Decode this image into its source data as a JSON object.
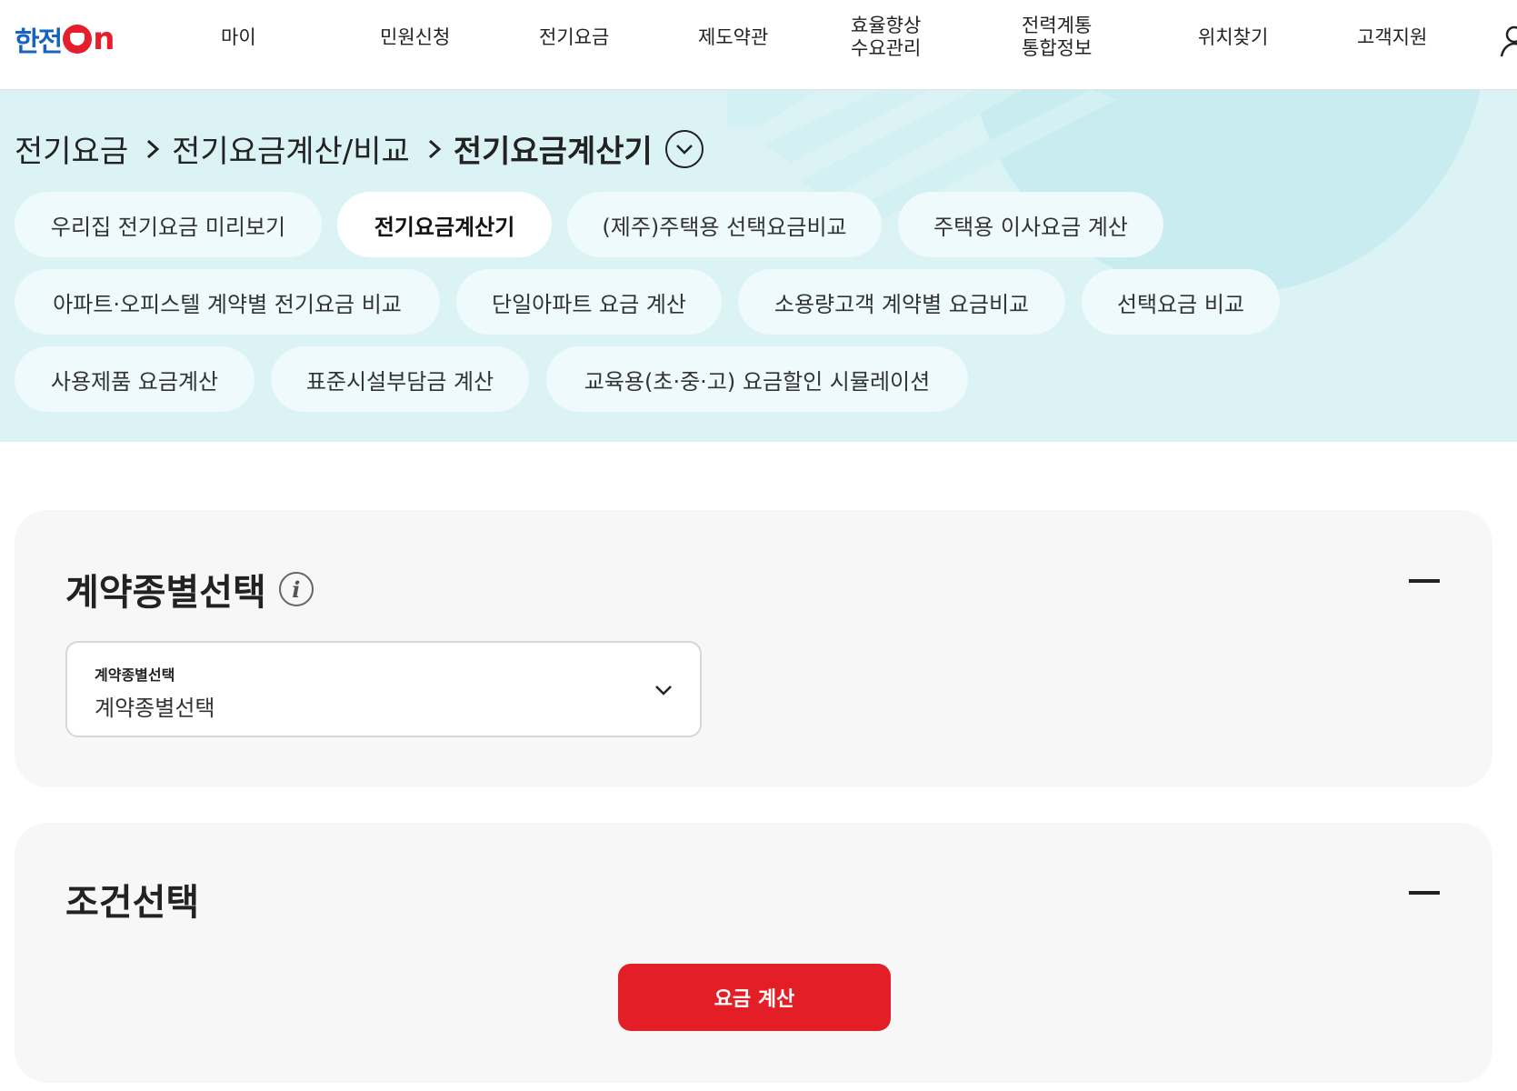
{
  "header": {
    "logo_text": "한전",
    "logo_on": "n",
    "nav": [
      {
        "line1": "마이",
        "line2": ""
      },
      {
        "line1": "민원신청",
        "line2": ""
      },
      {
        "line1": "전기요금",
        "line2": ""
      },
      {
        "line1": "제도약관",
        "line2": ""
      },
      {
        "line1": "효율향상",
        "line2": "수요관리"
      },
      {
        "line1": "전력계통",
        "line2": "통합정보"
      },
      {
        "line1": "위치찾기",
        "line2": ""
      },
      {
        "line1": "고객지원",
        "line2": ""
      }
    ]
  },
  "breadcrumb": {
    "items": [
      "전기요금",
      "전기요금계산/비교"
    ],
    "current": "전기요금계산기"
  },
  "chips": [
    {
      "label": "우리집 전기요금 미리보기",
      "active": false
    },
    {
      "label": "전기요금계산기",
      "active": true
    },
    {
      "label": "(제주)주택용 선택요금비교",
      "active": false
    },
    {
      "label": "주택용 이사요금 계산",
      "active": false
    },
    {
      "label": "아파트·오피스텔 계약별 전기요금 비교",
      "active": false
    },
    {
      "label": "단일아파트 요금 계산",
      "active": false
    },
    {
      "label": "소용량고객 계약별 요금비교",
      "active": false
    },
    {
      "label": "선택요금 비교",
      "active": false
    },
    {
      "label": "사용제품 요금계산",
      "active": false
    },
    {
      "label": "표준시설부담금 계산",
      "active": false
    },
    {
      "label": "교육용(초·중·고) 요금할인 시뮬레이션",
      "active": false
    }
  ],
  "contract_section": {
    "title": "계약종별선택",
    "select_label": "계약종별선택",
    "select_value": "계약종별선택"
  },
  "condition_section": {
    "title": "조건선택",
    "button_label": "요금 계산"
  },
  "colors": {
    "brand_blue": "#1565c0",
    "brand_red": "#e61e2b",
    "banner_bg": "#dcf3f6",
    "button_red": "#e41e26"
  }
}
